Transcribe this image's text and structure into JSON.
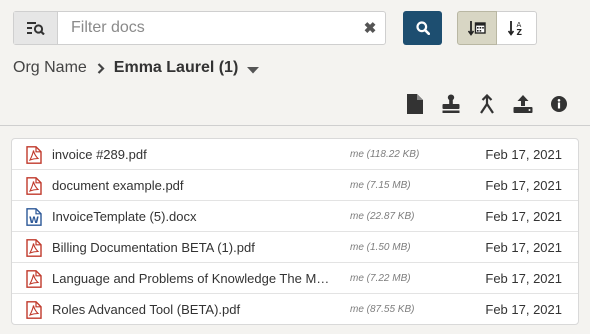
{
  "filter": {
    "placeholder": "Filter docs",
    "value": "",
    "clear_glyph": "✖"
  },
  "icons": {
    "filter_addon": "filter-list-search-icon",
    "search_button": "search-icon",
    "sort_date": "sort-by-date-icon",
    "sort_alpha": "sort-alpha-icon",
    "actions": [
      "new-document-icon",
      "stamp-icon",
      "merge-icon",
      "upload-icon",
      "info-icon"
    ]
  },
  "colors": {
    "primary": "#1d4e70",
    "pdf": "#c0392b",
    "word": "#2b5797",
    "sort_active_bg": "#d8d6c4"
  },
  "breadcrumb": {
    "org": "Org Name",
    "current": "Emma Laurel (1)"
  },
  "documents": [
    {
      "type": "pdf",
      "name": "invoice #289.pdf",
      "meta": "me (118.22 KB)",
      "date": "Feb 17, 2021"
    },
    {
      "type": "pdf",
      "name": "document example.pdf",
      "meta": "me (7.15 MB)",
      "date": "Feb 17, 2021"
    },
    {
      "type": "word",
      "name": "InvoiceTemplate (5).docx",
      "meta": "me (22.87 KB)",
      "date": "Feb 17, 2021"
    },
    {
      "type": "pdf",
      "name": "Billing Documentation BETA (1).pdf",
      "meta": "me (1.50 MB)",
      "date": "Feb 17, 2021"
    },
    {
      "type": "pdf",
      "name": "Language and Problems of Knowledge The M…",
      "meta": "me (7.22 MB)",
      "date": "Feb 17, 2021"
    },
    {
      "type": "pdf",
      "name": "Roles Advanced Tool (BETA).pdf",
      "meta": "me (87.55 KB)",
      "date": "Feb 17, 2021"
    }
  ]
}
